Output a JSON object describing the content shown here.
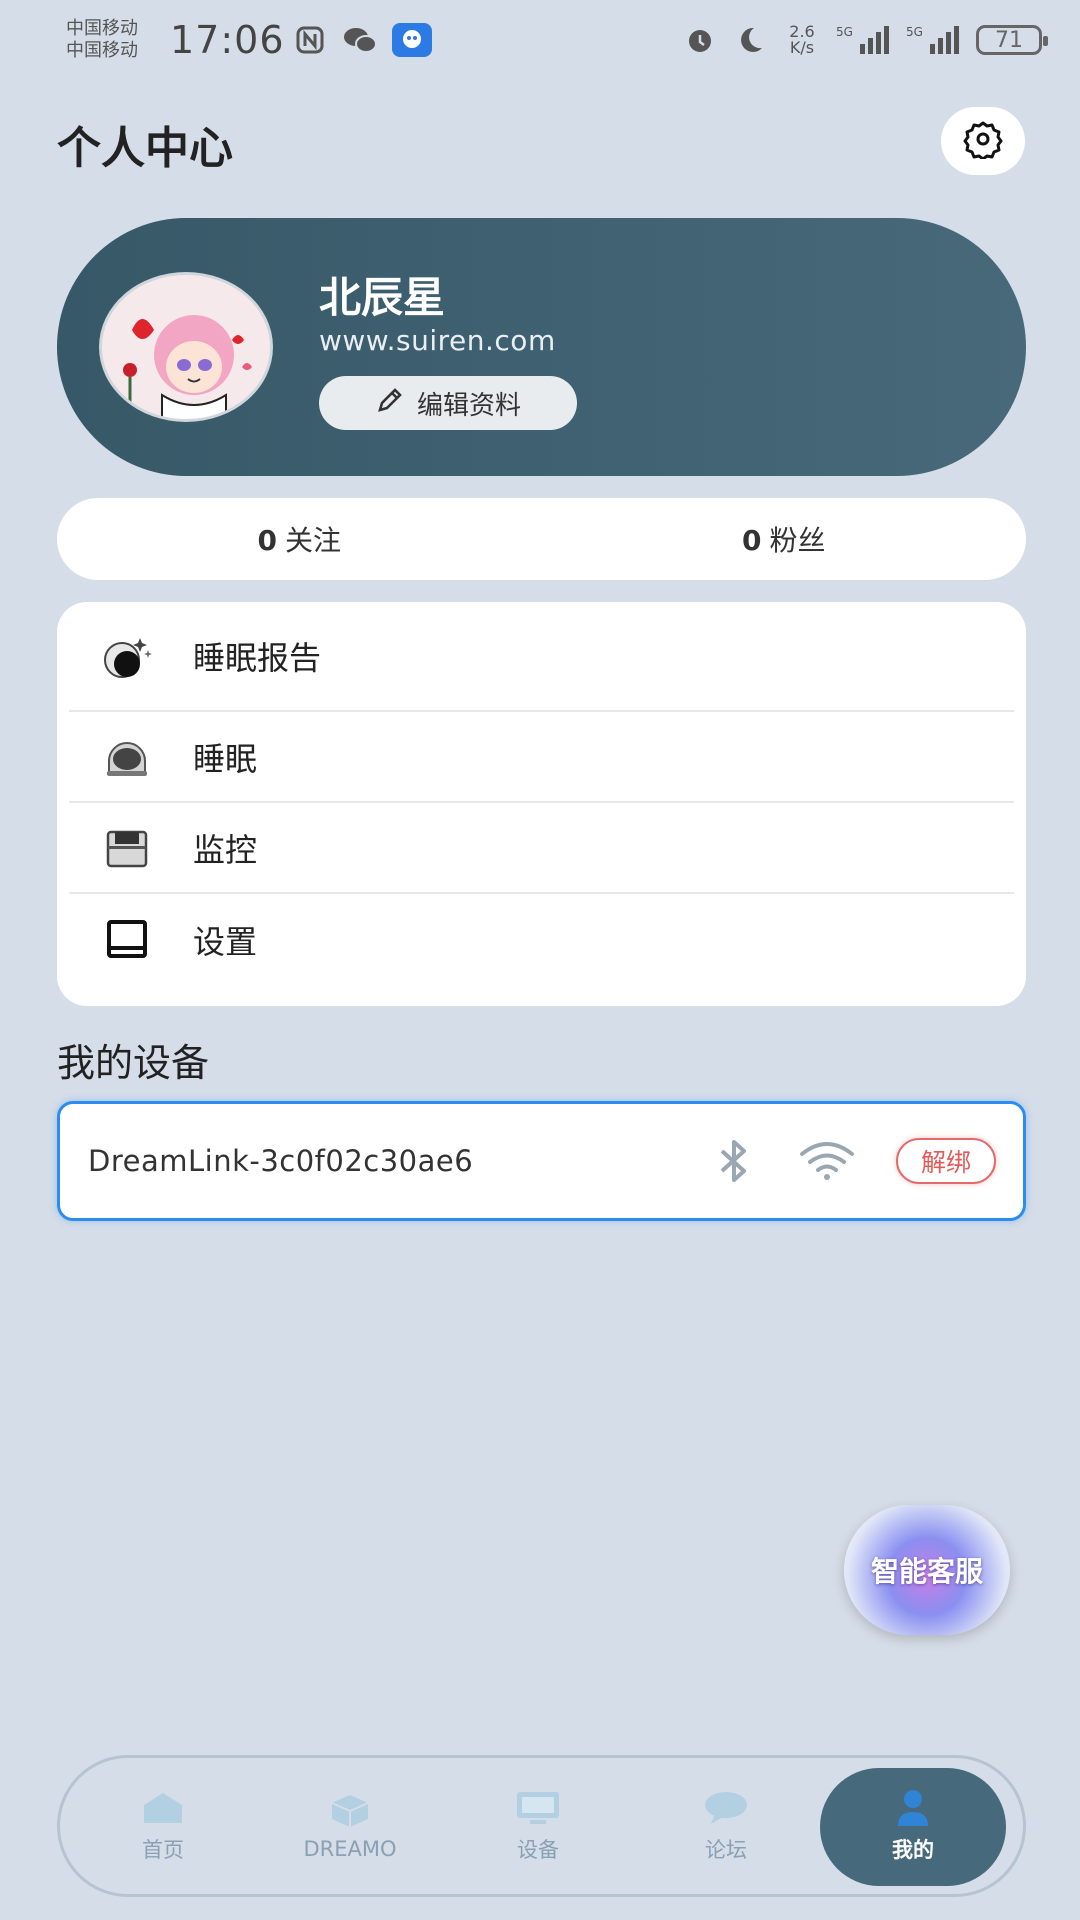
{
  "statusbar": {
    "carrier1": "中国移动",
    "carrier2": "中国移动",
    "time": "17:06",
    "net_speed": "2.6",
    "net_unit": "K/s",
    "signal1": "5G",
    "signal2": "5G",
    "battery": "71"
  },
  "header": {
    "title": "个人中心"
  },
  "profile": {
    "name": "北辰星",
    "website": "www.suiren.com",
    "edit_label": "编辑资料"
  },
  "stats": {
    "following_count": "0",
    "following_label": "关注",
    "followers_count": "0",
    "followers_label": "粉丝"
  },
  "menu": {
    "items": [
      {
        "label": "睡眠报告",
        "icon": "sleep-report-icon"
      },
      {
        "label": "睡眠",
        "icon": "sleep-icon"
      },
      {
        "label": "监控",
        "icon": "monitor-icon"
      },
      {
        "label": "设置",
        "icon": "settings-book-icon"
      }
    ]
  },
  "devices": {
    "title": "我的设备",
    "items": [
      {
        "name": "DreamLink-3c0f02c30ae6",
        "unbind_label": "解绑"
      }
    ]
  },
  "service": {
    "label": "智能客服"
  },
  "nav": {
    "items": [
      {
        "label": "首页",
        "icon": "home-icon"
      },
      {
        "label": "DREAMO",
        "icon": "cube-icon"
      },
      {
        "label": "设备",
        "icon": "monitor-screen-icon"
      },
      {
        "label": "论坛",
        "icon": "chat-bubble-icon"
      },
      {
        "label": "我的",
        "icon": "person-icon",
        "active": true
      }
    ]
  },
  "colors": {
    "background": "#d5dde8",
    "profile_card": "#3f6272",
    "accent_blue": "#2b8df0",
    "unbind_red": "#e45a5a",
    "nav_active": "#46697b"
  }
}
